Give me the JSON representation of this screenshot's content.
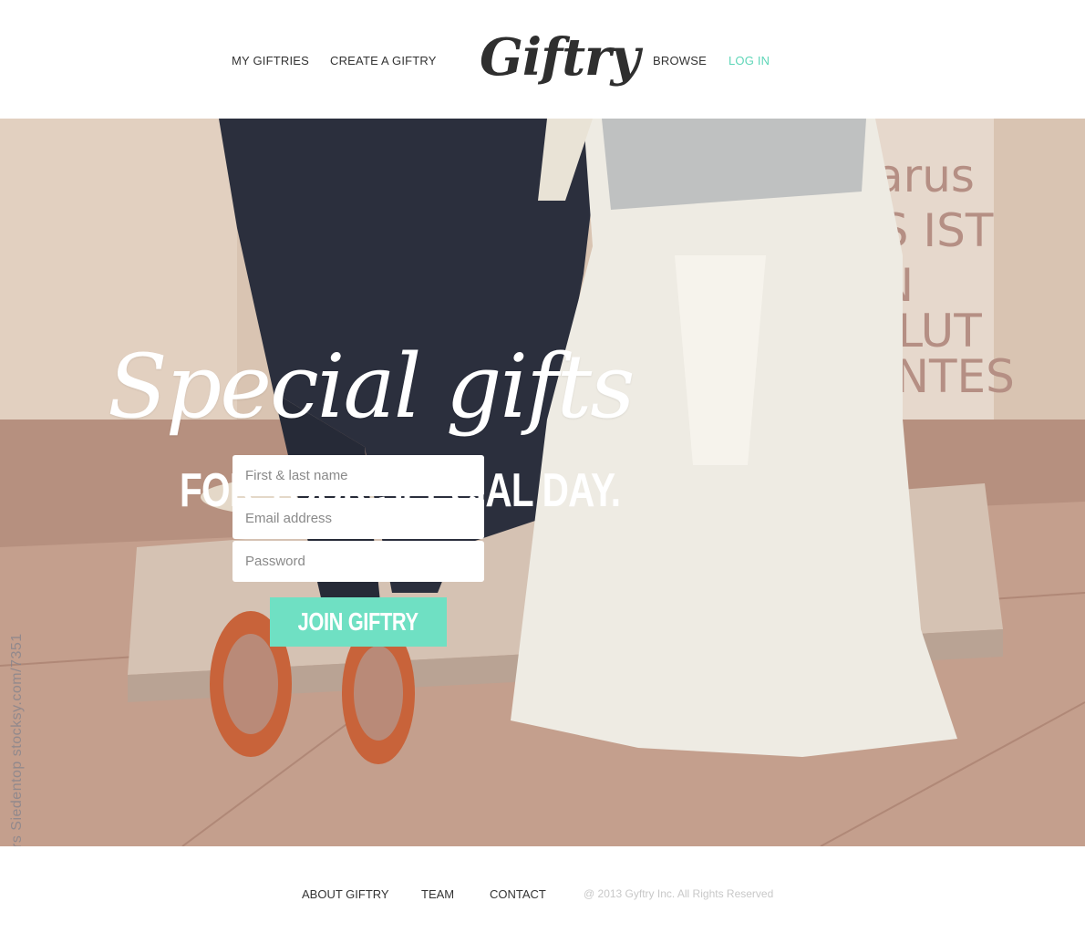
{
  "header": {
    "nav_left": [
      "MY GIFTRIES",
      "CREATE A GIFTRY"
    ],
    "logo": "Giftry",
    "nav_right": [
      "BROWSE",
      "LOG IN"
    ]
  },
  "hero": {
    "headline_script": "Special gifts",
    "headline_caps": "FOR YOUR SPECIAL DAY.",
    "form": {
      "name_placeholder": "First & last name",
      "email_placeholder": "Email address",
      "password_placeholder": "Password",
      "submit_label": "JOIN GIFTRY"
    },
    "photo_credit": "rs Siedentop  stocksy.com/7351"
  },
  "footer": {
    "links": [
      "ABOUT GIFTRY",
      "TEAM",
      "CONTACT"
    ],
    "copyright": "@ 2013 Gyftry Inc. All Rights Reserved"
  },
  "colors": {
    "accent": "#6fe0c3",
    "active_nav": "#5fd6b8",
    "text": "#333333"
  }
}
